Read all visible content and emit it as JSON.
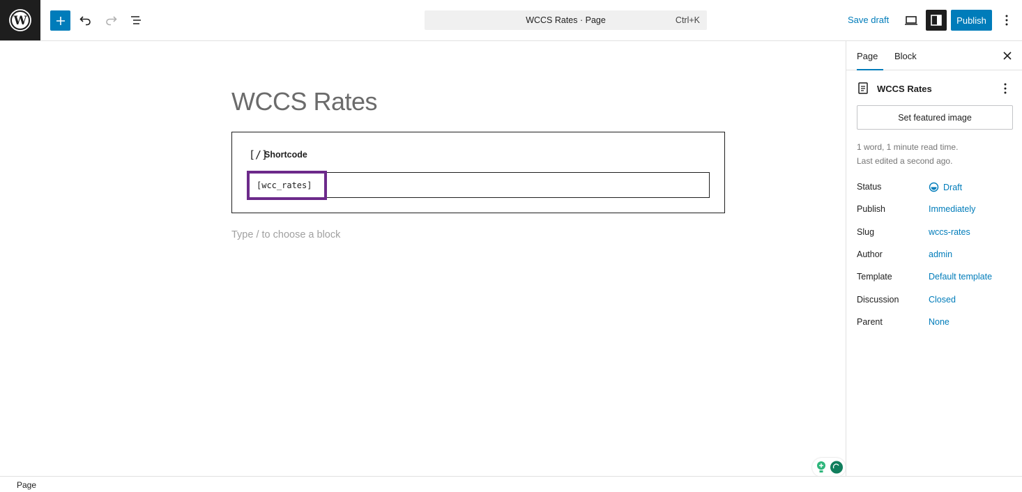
{
  "header": {
    "document_title": "WCCS Rates · Page",
    "shortcut": "Ctrl+K",
    "save_draft_label": "Save draft",
    "publish_label": "Publish"
  },
  "editor": {
    "page_title": "WCCS Rates",
    "shortcode_block": {
      "icon_text": "[/]",
      "label": "Shortcode",
      "value": "[wcc_rates]"
    },
    "placeholder": "Type / to choose a block"
  },
  "sidebar": {
    "tabs": [
      {
        "label": "Page"
      },
      {
        "label": "Block"
      }
    ],
    "document_title": "WCCS Rates",
    "featured_image_label": "Set featured image",
    "meta": {
      "read_time": "1 word, 1 minute read time.",
      "last_edited": "Last edited a second ago."
    },
    "properties": [
      {
        "label": "Status",
        "value": "Draft"
      },
      {
        "label": "Publish",
        "value": "Immediately"
      },
      {
        "label": "Slug",
        "value": "wccs-rates"
      },
      {
        "label": "Author",
        "value": "admin"
      },
      {
        "label": "Template",
        "value": "Default template"
      },
      {
        "label": "Discussion",
        "value": "Closed"
      },
      {
        "label": "Parent",
        "value": "None"
      }
    ]
  },
  "footer": {
    "breadcrumb": "Page"
  },
  "colors": {
    "accent": "#007cba",
    "highlight": "#6c2a8a",
    "dark": "#1e1e1e"
  }
}
